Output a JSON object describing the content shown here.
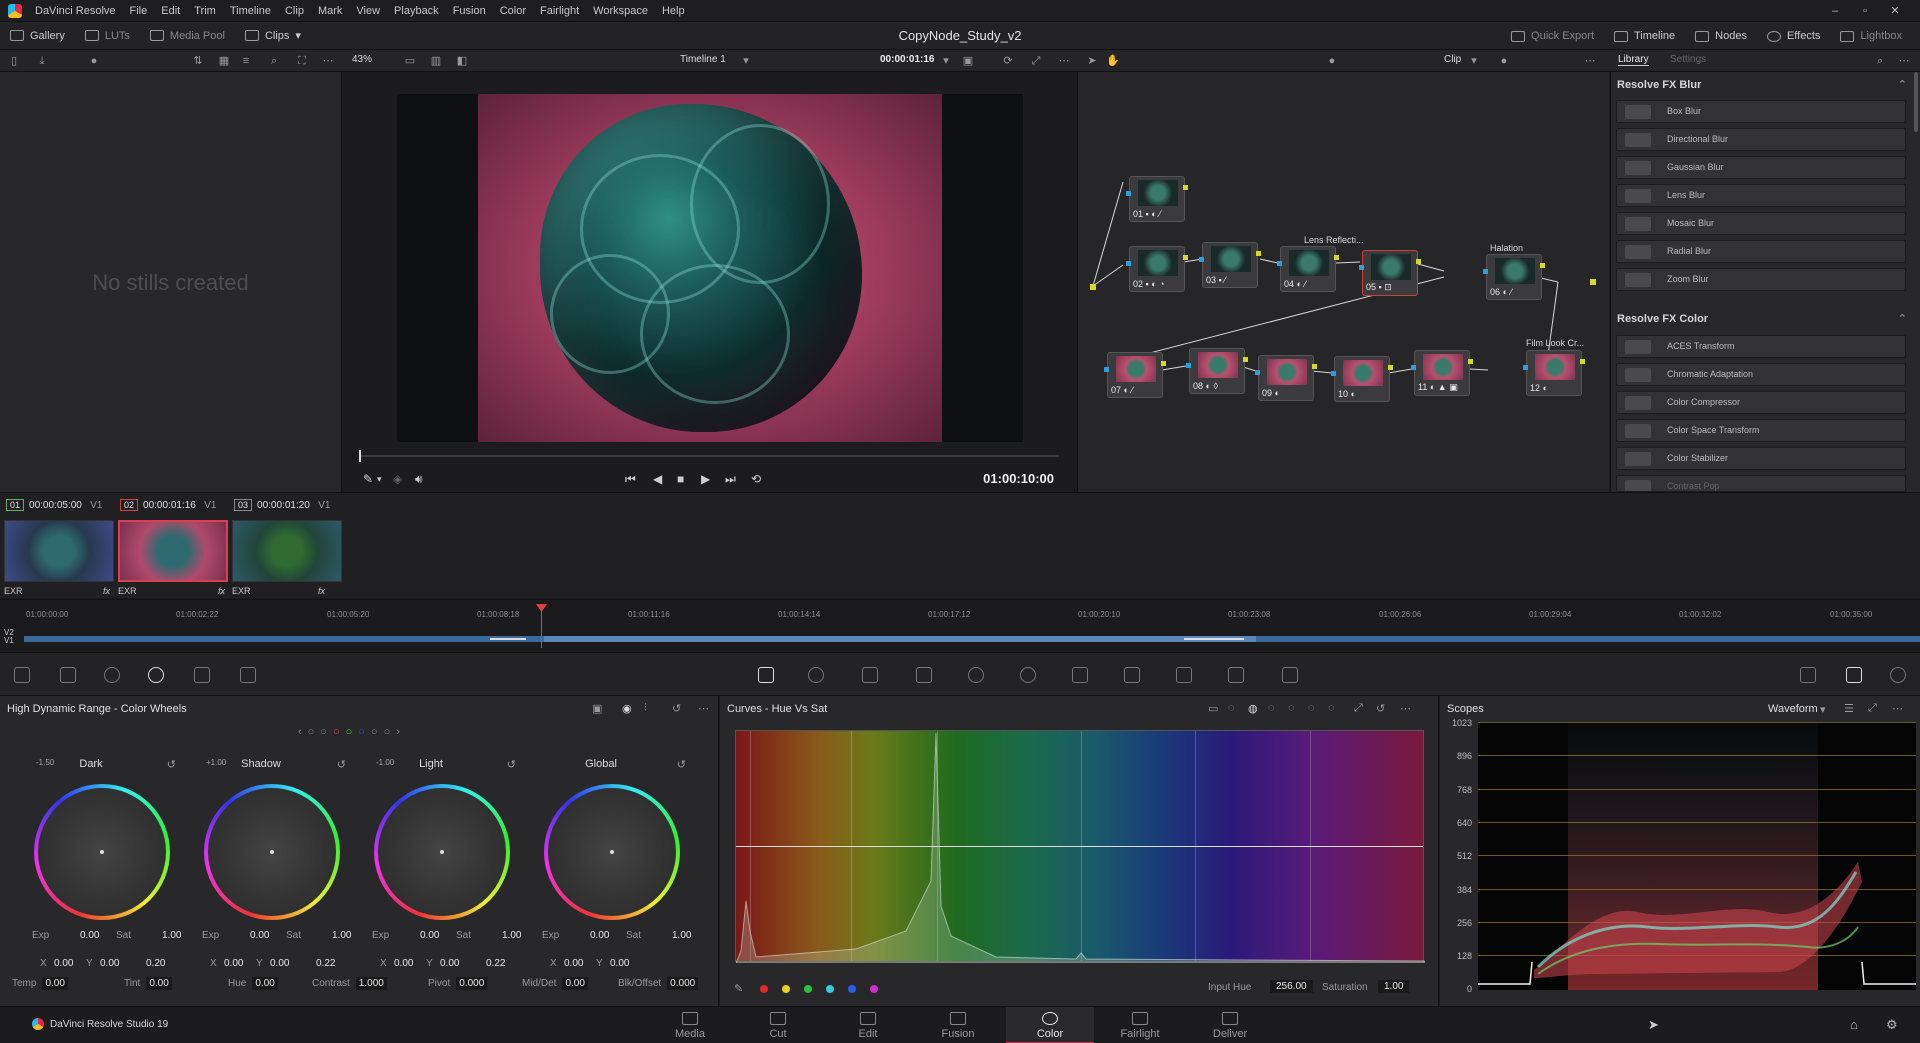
{
  "app": {
    "name": "DaVinci Resolve",
    "menus": [
      "File",
      "Edit",
      "Trim",
      "Timeline",
      "Clip",
      "Mark",
      "View",
      "Playback",
      "Fusion",
      "Color",
      "Fairlight",
      "Workspace",
      "Help"
    ],
    "project_title": "CopyNode_Study_v2",
    "brand_footer": "DaVinci Resolve Studio 19"
  },
  "toolbar": {
    "gallery": "Gallery",
    "luts": "LUTs",
    "media_pool": "Media Pool",
    "clips": "Clips",
    "quick_export": "Quick Export",
    "timeline": "Timeline",
    "nodes": "Nodes",
    "effects": "Effects",
    "lightbox": "Lightbox"
  },
  "subtoolbar": {
    "zoom": "43%",
    "timeline_name": "Timeline 1",
    "timecode": "00:00:01:16",
    "clip_mode": "Clip",
    "tab_library": "Library",
    "tab_settings": "Settings"
  },
  "gallery": {
    "empty_text": "No stills created"
  },
  "viewer": {
    "timecode": "01:00:10:00"
  },
  "nodes": [
    {
      "label": "01 ▪ ◐ ⁄"
    },
    {
      "label": "02 ▪ ◐ ◔"
    },
    {
      "label": "03 ▪ ⁄"
    },
    {
      "label": "04 ◐ ⁄",
      "title": "Lens Reflecti..."
    },
    {
      "label": "05 ▪ ⊡"
    },
    {
      "label": "06 ◐ ⁄",
      "title": "Halation"
    },
    {
      "label": "07 ◐ ⁄"
    },
    {
      "label": "08 ◐ ◊"
    },
    {
      "label": "09 ◐"
    },
    {
      "label": "10 ◐"
    },
    {
      "label": "11 ◐ ▲ ▣"
    },
    {
      "label": "12 ◐",
      "title": "Film Look Cr..."
    }
  ],
  "library": {
    "section_blur": "Resolve FX Blur",
    "blur_items": [
      "Box Blur",
      "Directional Blur",
      "Gaussian Blur",
      "Lens Blur",
      "Mosaic Blur",
      "Radial Blur",
      "Zoom Blur"
    ],
    "section_color": "Resolve FX Color",
    "color_items": [
      "ACES Transform",
      "Chromatic Adaptation",
      "Color Compressor",
      "Color Space Transform",
      "Color Stabilizer",
      "Contrast Pop"
    ]
  },
  "clips": [
    {
      "num": "01",
      "tc": "00:00:05:00",
      "track": "V1",
      "format": "EXR",
      "fx": ""
    },
    {
      "num": "02",
      "tc": "00:00:01:16",
      "track": "V1",
      "format": "EXR",
      "fx": "fx"
    },
    {
      "num": "03",
      "tc": "00:00:01:20",
      "track": "V1",
      "format": "EXR",
      "fx": "fx"
    }
  ],
  "fx_label_3": "fx",
  "minitimeline": {
    "ruler": [
      "01:00:00:00",
      "01:00:02:22",
      "01:00:05:20",
      "01:00:08:18",
      "01:00:11:16",
      "01:00:14:14",
      "01:00:17:12",
      "01:00:20:10",
      "01:00:23:08",
      "01:00:26:06",
      "01:00:29:04",
      "01:00:32:02",
      "01:00:35:00"
    ],
    "track_v2": "V2",
    "track_v1": "V1"
  },
  "wheels": {
    "title": "High Dynamic Range - Color Wheels",
    "items": [
      {
        "name": "Dark",
        "zone": "-1.50",
        "exp": "0.00",
        "sat": "1.00",
        "x": "0.00",
        "y": "0.00",
        "z": "0.20"
      },
      {
        "name": "Shadow",
        "zone": "+1.00",
        "exp": "0.00",
        "sat": "1.00",
        "x": "0.00",
        "y": "0.00",
        "z": "0.22"
      },
      {
        "name": "Light",
        "zone": "-1.00",
        "exp": "0.00",
        "sat": "1.00",
        "x": "0.00",
        "y": "0.00",
        "z": "0.22"
      },
      {
        "name": "Global",
        "zone": "",
        "exp": "0.00",
        "sat": "1.00",
        "x": "0.00",
        "y": "0.00",
        "z": ""
      }
    ],
    "labels": {
      "exp": "Exp",
      "sat": "Sat",
      "x": "X",
      "y": "Y"
    },
    "bottom": [
      {
        "label": "Temp",
        "value": "0.00"
      },
      {
        "label": "Tint",
        "value": "0.00"
      },
      {
        "label": "Hue",
        "value": "0.00"
      },
      {
        "label": "Contrast",
        "value": "1.000"
      },
      {
        "label": "Pivot",
        "value": "0.000"
      },
      {
        "label": "Mid/Det",
        "value": "0.00"
      },
      {
        "label": "Blk/Offset",
        "value": "0.000"
      }
    ]
  },
  "curves": {
    "title": "Curves - Hue Vs Sat",
    "input_hue_label": "Input Hue",
    "input_hue": "256.00",
    "saturation_label": "Saturation",
    "saturation": "1.00",
    "swatches": [
      "#e0282d",
      "#e8d21e",
      "#28c43c",
      "#35c8e6",
      "#2a5ee8",
      "#d22ad6"
    ]
  },
  "scopes": {
    "title": "Scopes",
    "mode": "Waveform",
    "scale": [
      "1023",
      "896",
      "768",
      "640",
      "512",
      "384",
      "256",
      "128",
      "0"
    ]
  },
  "pages": [
    "Media",
    "Cut",
    "Edit",
    "Fusion",
    "Color",
    "Fairlight",
    "Deliver"
  ],
  "active_page": "Color"
}
